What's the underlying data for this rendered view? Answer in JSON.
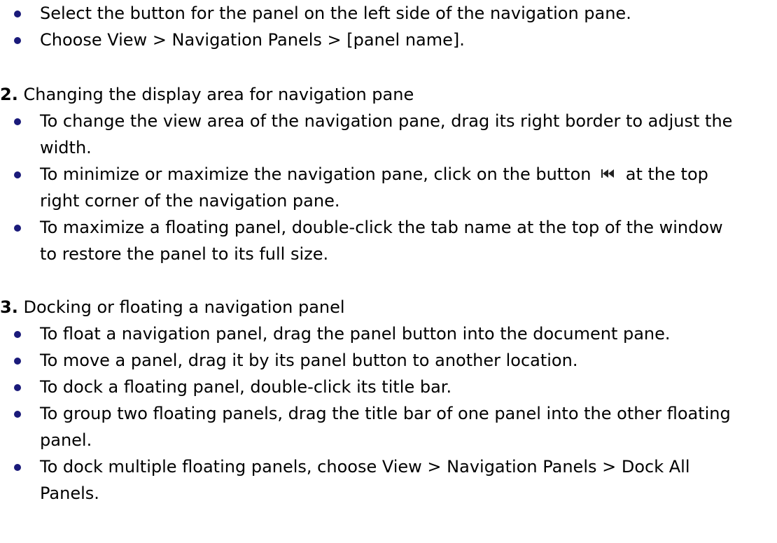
{
  "section1": {
    "bullets": [
      "Select the button for the panel on the left side of the navigation pane.",
      "Choose View > Navigation Panels > [panel name]."
    ]
  },
  "section2": {
    "number": "2.",
    "heading": "Changing the display area for navigation pane",
    "bullet1": "To change the view area of the navigation pane, drag its right border to adjust the width.",
    "bullet2_before": "To minimize or maximize the navigation pane, click on the button",
    "bullet2_icon": "rewind-double-arrow-icon",
    "bullet2_after": "at the top right corner of the navigation pane.",
    "bullet3": "To maximize a floating panel, double-click the tab name at the top of the window to restore the panel to its full size."
  },
  "section3": {
    "number": "3.",
    "heading": "Docking or floating a navigation panel",
    "bullets": [
      "To float a navigation panel, drag the panel button into the document pane.",
      "To move a panel, drag it by its panel button to another location.",
      "To dock a floating panel, double-click its title bar.",
      "To group two floating panels, drag the title bar of one panel into the other floating panel.",
      "To dock multiple floating panels, choose View > Navigation Panels > Dock All Panels."
    ]
  },
  "colors": {
    "bullet": "#1a1a7a",
    "text": "#000000",
    "background": "#ffffff"
  }
}
